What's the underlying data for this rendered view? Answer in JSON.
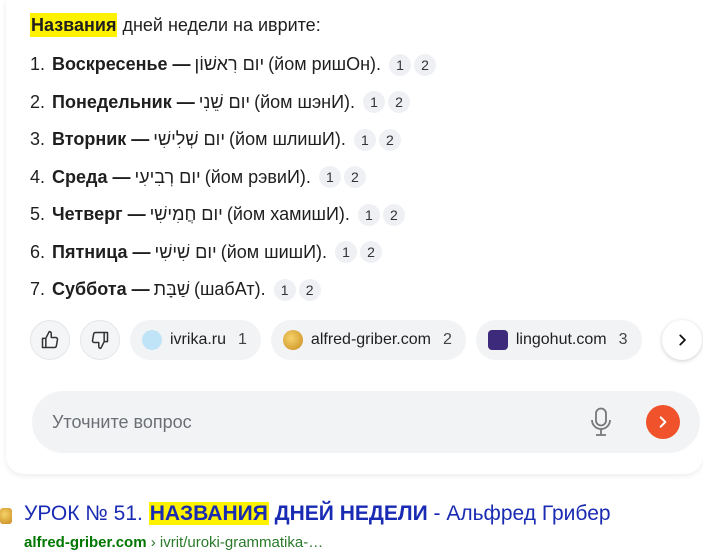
{
  "answer": {
    "heading_highlight": "Названия",
    "heading_rest": " дней недели на иврите",
    "heading_colon": ":",
    "days": [
      {
        "num": "1.",
        "ru": "Воскресенье —",
        "he": "יום רִאשׁוֹן",
        "tr": "(йом ришОн).",
        "refs": [
          "1",
          "2"
        ]
      },
      {
        "num": "2.",
        "ru": "Понедельник —",
        "he": "יום שֵׁנִי",
        "tr": "(йом шэнИ).",
        "refs": [
          "1",
          "2"
        ]
      },
      {
        "num": "3.",
        "ru": "Вторник —",
        "he": "יום שְׁלִישִׁי",
        "tr": "(йом шлишИ).",
        "refs": [
          "1",
          "2"
        ]
      },
      {
        "num": "4.",
        "ru": "Среда —",
        "he": "יום רְבִיעִי",
        "tr": "(йом рэвиИ).",
        "refs": [
          "1",
          "2"
        ]
      },
      {
        "num": "5.",
        "ru": "Четверг —",
        "he": "יום חֲמִישִׁי",
        "tr": "(йом хамишИ).",
        "refs": [
          "1",
          "2"
        ]
      },
      {
        "num": "6.",
        "ru": "Пятница —",
        "he": "יום שִׁישִׁי",
        "tr": "(йом шишИ).",
        "refs": [
          "1",
          "2"
        ]
      },
      {
        "num": "7.",
        "ru": "Суббота —",
        "he": "שַׁבָּת",
        "tr": "(шабАт).",
        "refs": [
          "1",
          "2"
        ]
      }
    ]
  },
  "sources": [
    {
      "name": "ivrika.ru",
      "count": "1",
      "icon": "ivrika-favicon",
      "color": "#bfe3f7"
    },
    {
      "name": "alfred-griber.com",
      "count": "2",
      "icon": "alfred-griber-favicon",
      "color": "#e0a82e"
    },
    {
      "name": "lingohut.com",
      "count": "3",
      "icon": "lingohut-favicon",
      "color": "#3d2a7a"
    }
  ],
  "ask": {
    "placeholder": "Уточните вопрос"
  },
  "result": {
    "title_prefix": "УРОК № 51. ",
    "title_highlight": "НАЗВАНИЯ",
    "title_caps": " ДНЕЙ НЕДЕЛИ",
    "title_suffix": " - Альфред Грибер",
    "domain": "alfred-griber.com",
    "path": " › ivrit/uroki-grammatika-…"
  },
  "colors": {
    "link": "#1a2bb3",
    "url_green": "#007700",
    "highlight": "#fff200",
    "send": "#f0522b"
  }
}
